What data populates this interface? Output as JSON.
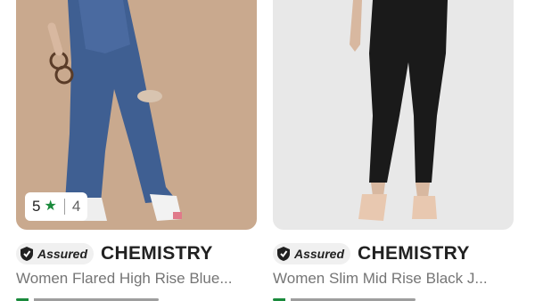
{
  "products": [
    {
      "rating": "5",
      "rating_count": "4",
      "assured_label": "Assured",
      "brand": "CHEMISTRY",
      "title": "Women Flared High Rise Blue...",
      "image_icon": "blue-flared-jeans"
    },
    {
      "assured_label": "Assured",
      "brand": "CHEMISTRY",
      "title": "Women Slim Mid Rise Black J...",
      "image_icon": "black-slim-jeans"
    }
  ],
  "colors": {
    "star": "#1a8a3c",
    "left_bg": "#c9a98e",
    "right_bg": "#e8e8e8",
    "title_grey": "#757575"
  }
}
